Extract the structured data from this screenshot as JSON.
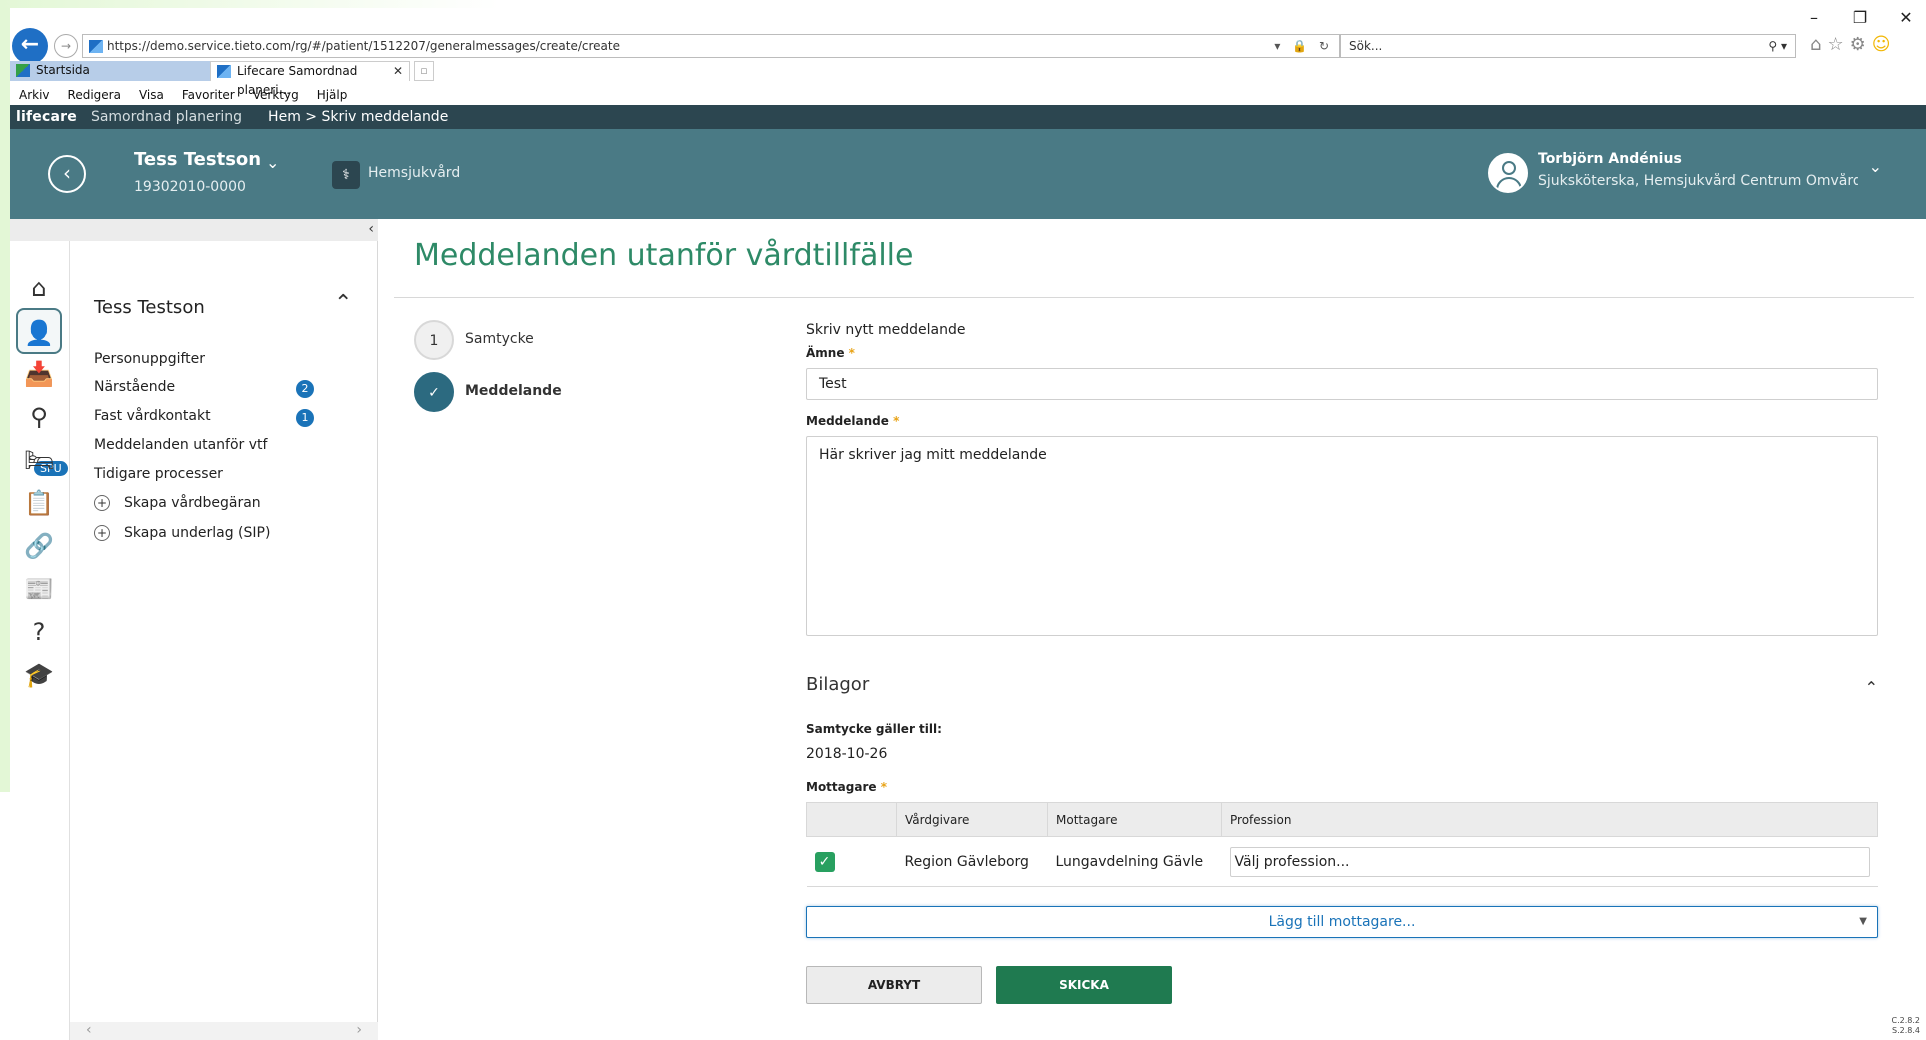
{
  "browser": {
    "url": "https://demo.service.tieto.com/rg/#/patient/1512207/generalmessages/create/create",
    "search_placeholder": "Sök...",
    "tabs": [
      {
        "label": "Startsida"
      },
      {
        "label": "Lifecare Samordnad planeri..."
      }
    ],
    "menu": [
      "Arkiv",
      "Redigera",
      "Visa",
      "Favoriter",
      "Verktyg",
      "Hjälp"
    ]
  },
  "app": {
    "brand": "lifecare",
    "module": "Samordnad planering",
    "breadcrumb": "Hem > Skriv meddelande"
  },
  "patient": {
    "name": "Tess Testson",
    "id": "19302010-0000",
    "unit": "Hemsjukvård"
  },
  "user": {
    "name": "Torbjörn Andénius",
    "role": "Sjuksköterska, Hemsjukvård Centrum Omvårdn..."
  },
  "rail": {
    "spu_badge": "SPU"
  },
  "panel": {
    "title": "Tess Testson",
    "items": [
      {
        "label": "Personuppgifter"
      },
      {
        "label": "Närstående",
        "badge": "2"
      },
      {
        "label": "Fast vårdkontakt",
        "badge": "1"
      },
      {
        "label": "Meddelanden utanför vtf"
      },
      {
        "label": "Tidigare processer"
      },
      {
        "label": "Skapa vårdbegäran"
      },
      {
        "label": "Skapa underlag (SIP)"
      }
    ]
  },
  "main": {
    "title": "Meddelanden utanför vårdtillfälle",
    "steps": [
      {
        "number": "1",
        "label": "Samtycke"
      },
      {
        "number": "✓",
        "label": "Meddelande"
      }
    ],
    "form": {
      "heading": "Skriv nytt meddelande",
      "subject_label": "Ämne",
      "subject_value": "Test",
      "message_label": "Meddelande",
      "message_value": "Här skriver jag mitt meddelande",
      "attachments_title": "Bilagor",
      "consent_label": "Samtycke gäller till:",
      "consent_value": "2018-10-26",
      "recipients_label": "Mottagare",
      "required_mark": "*",
      "table_headers": [
        "",
        "Vårdgivare",
        "Mottagare",
        "Profession"
      ],
      "rows": [
        {
          "checked": true,
          "provider": "Region Gävleborg",
          "recipient": "Lungavdelning Gävle",
          "profession_placeholder": "Välj profession..."
        }
      ],
      "add_recipient": "Lägg till mottagare...",
      "cancel": "AVBRYT",
      "send": "SKICKA"
    }
  },
  "version": [
    "C.2.8.2",
    "S.2.8.4"
  ],
  "colors": {
    "header_dark": "#2c4650",
    "header_teal": "#4a7a85",
    "title_green": "#2e8a67",
    "badge_blue": "#1a73b8",
    "send_green": "#1f7a50",
    "check_green": "#28a060",
    "required_orange": "#e8a317"
  }
}
